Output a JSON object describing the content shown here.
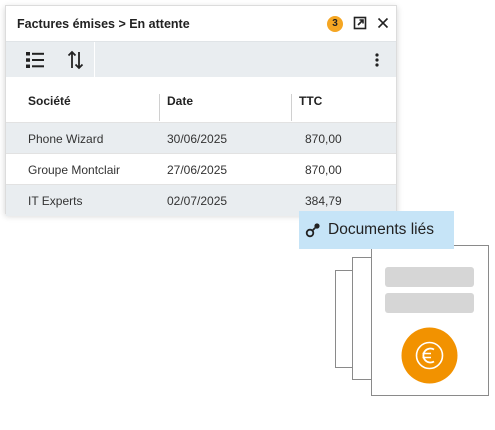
{
  "panel": {
    "title": "Factures émises > En attente",
    "badge_count": "3",
    "icons": [
      "open-external-icon",
      "close-icon",
      "list-icon",
      "sort-icon",
      "more-vertical-icon"
    ]
  },
  "table": {
    "columns": [
      "Société",
      "Date",
      "TTC"
    ],
    "rows": [
      {
        "societe": "Phone Wizard",
        "date": "30/06/2025",
        "ttc": "870,00"
      },
      {
        "societe": "Groupe Montclair",
        "date": "27/06/2025",
        "ttc": "870,00"
      },
      {
        "societe": "IT Experts",
        "date": "02/07/2025",
        "ttc": "384,79"
      }
    ]
  },
  "documents": {
    "label": "Documents liés",
    "icon": "link-icon",
    "symbol_icon": "euro-icon"
  },
  "colors": {
    "badge": "#f5a623",
    "toolbar": "#e9edf0",
    "alt_row": "#e9edf0",
    "docs_label_bg": "#c6e4f7",
    "euro_circle": "#f29200"
  }
}
